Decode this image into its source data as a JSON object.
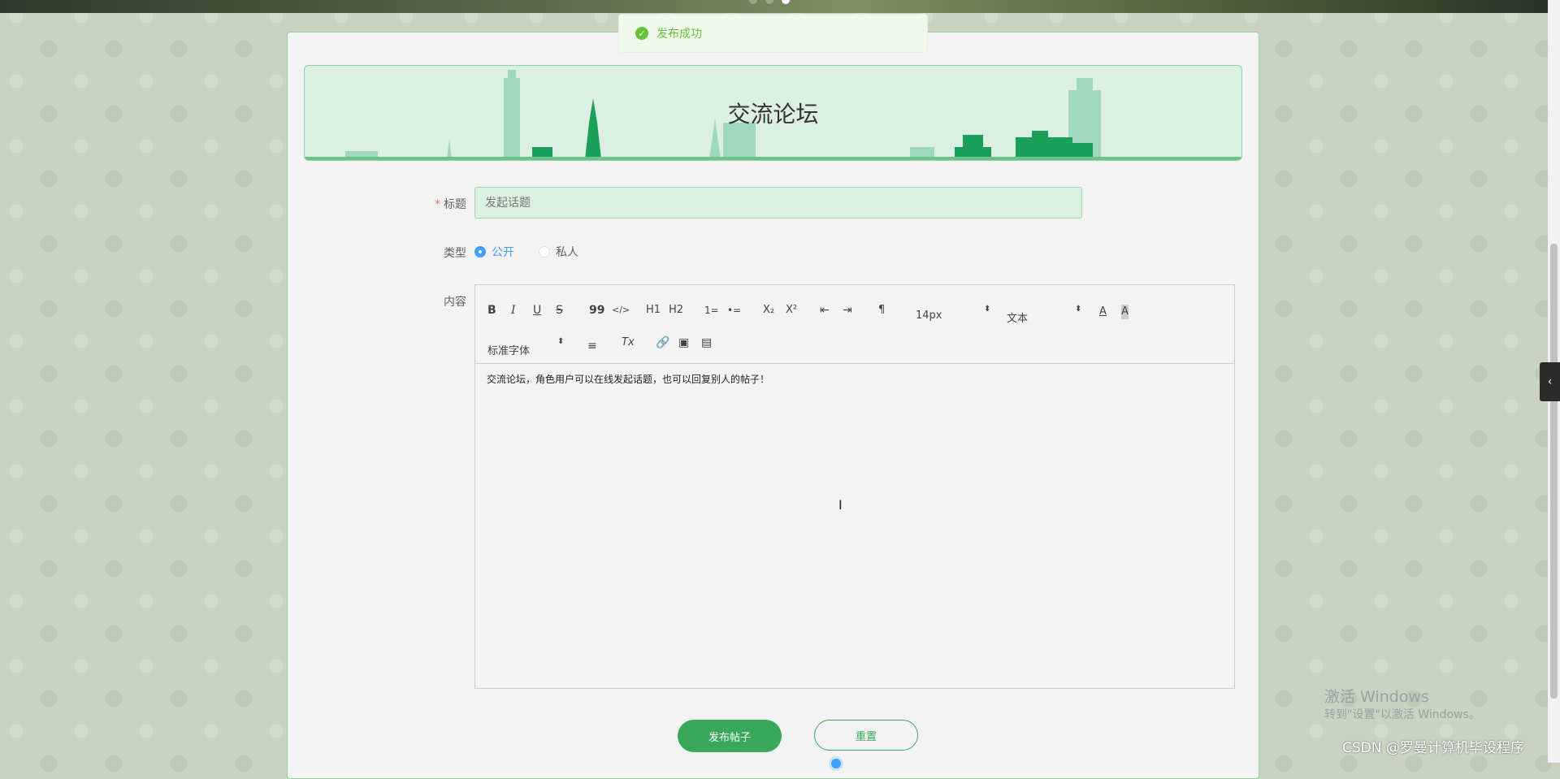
{
  "toast": {
    "message": "发布成功"
  },
  "banner": {
    "title": "交流论坛"
  },
  "form": {
    "title_label": "标题",
    "title_required": "*",
    "title_placeholder": "发起话题",
    "type_label": "类型",
    "type_options": [
      {
        "label": "公开",
        "checked": true
      },
      {
        "label": "私人",
        "checked": false
      }
    ],
    "content_label": "内容"
  },
  "editor": {
    "toolbar": {
      "bold": "B",
      "italic": "I",
      "underline": "U",
      "strike": "S",
      "blockquote": "99",
      "code": "</>",
      "h1": "H1",
      "h2": "H2",
      "ordered_list": "1=",
      "bullet_list": "•=",
      "subscript": "X₂",
      "superscript": "X²",
      "outdent": "⇤",
      "indent": "⇥",
      "direction": "¶",
      "size_value": "14px",
      "header_value": "文本",
      "font_value": "标准字体",
      "align": "≡",
      "clean": "Tx"
    },
    "content": "交流论坛，角色用户可以在线发起话题，也可以回复别人的帖子！"
  },
  "buttons": {
    "submit": "发布帖子",
    "reset": "重置"
  },
  "watermark": {
    "line1": "激活 Windows",
    "line2": "转到\"设置\"以激活 Windows。"
  },
  "credit": "CSDN @罗曼计算机毕设程序",
  "colors": {
    "accent": "#3aa85a",
    "success": "#67c23a",
    "radio": "#409eff"
  }
}
